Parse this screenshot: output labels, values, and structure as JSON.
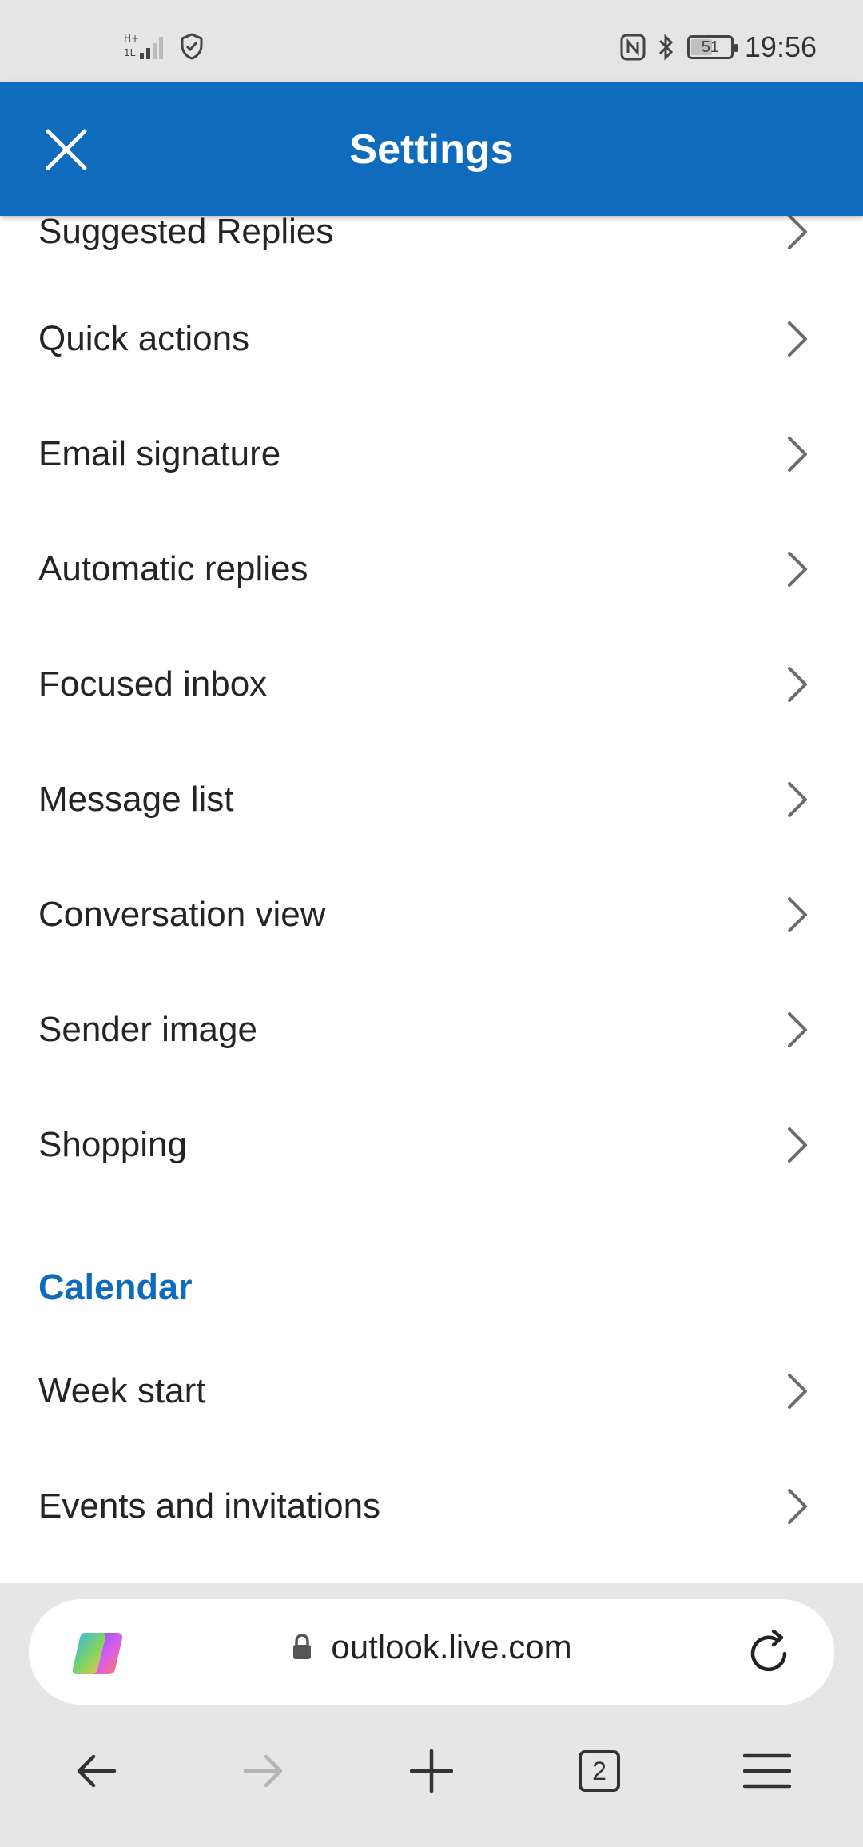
{
  "status_bar": {
    "time": "19:56",
    "battery": "51",
    "battery_level": 0.51
  },
  "header": {
    "title": "Settings",
    "close_icon": "close-icon"
  },
  "mail_items": [
    {
      "label": "Suggested Replies"
    },
    {
      "label": "Quick actions"
    },
    {
      "label": "Email signature"
    },
    {
      "label": "Automatic replies"
    },
    {
      "label": "Focused inbox"
    },
    {
      "label": "Message list"
    },
    {
      "label": "Conversation view"
    },
    {
      "label": "Sender image"
    },
    {
      "label": "Shopping"
    }
  ],
  "calendar": {
    "section_title": "Calendar",
    "items": [
      {
        "label": "Week start"
      },
      {
        "label": "Events and invitations"
      }
    ]
  },
  "browser": {
    "url": "outlook.live.com",
    "tab_count": "2"
  },
  "colors": {
    "brand": "#0f6cbd",
    "text": "#242424",
    "chevron": "#6b6b6b"
  }
}
